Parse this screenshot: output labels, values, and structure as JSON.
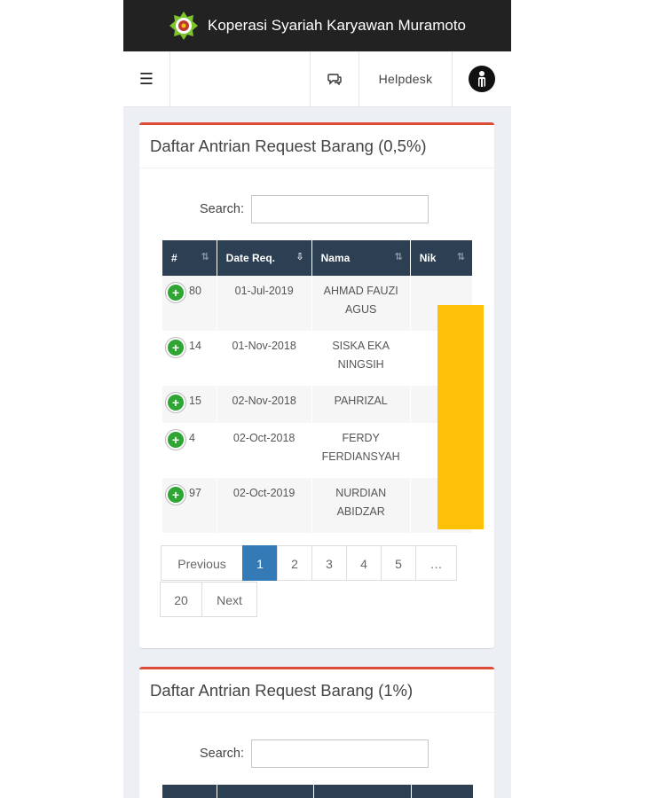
{
  "app": {
    "title": "Koperasi Syariah Karyawan Muramoto"
  },
  "navbar": {
    "menu_icon": "hamburger-icon",
    "chat_icon": "comments-icon",
    "helpdesk_label": "Helpdesk",
    "avatar_icon": "user-avatar"
  },
  "panel1": {
    "title": "Daftar Antrian Request Barang (0,5%)",
    "search_label": "Search:",
    "search_value": "",
    "columns": [
      "#",
      "Date Req.",
      "Nama",
      "Nik"
    ],
    "rows": [
      {
        "id": "80",
        "date": "01-Jul-2019",
        "name_line1": "AHMAD FAUZI",
        "name_line2": "AGUS"
      },
      {
        "id": "14",
        "date": "01-Nov-2018",
        "name_line1": "SISKA EKA",
        "name_line2": "NINGSIH"
      },
      {
        "id": "15",
        "date": "02-Nov-2018",
        "name_line1": "PAHRIZAL",
        "name_line2": ""
      },
      {
        "id": "4",
        "date": "02-Oct-2018",
        "name_line1": "FERDY",
        "name_line2": "FERDIANSYAH"
      },
      {
        "id": "97",
        "date": "02-Oct-2019",
        "name_line1": "NURDIAN",
        "name_line2": "ABIDZAR"
      }
    ],
    "pagination": {
      "previous": "Previous",
      "pages": [
        "1",
        "2",
        "3",
        "4",
        "5",
        "…",
        "20"
      ],
      "next": "Next",
      "current": "1"
    }
  },
  "panel2": {
    "title": "Daftar Antrian Request Barang (1%)",
    "search_label": "Search:",
    "search_value": ""
  },
  "colors": {
    "header_bg": "#222222",
    "box_accent": "#dd4b39",
    "table_header": "#2d3f52",
    "page_active": "#337ab7",
    "expand_green": "#2fa533",
    "redaction": "#ffc107"
  }
}
